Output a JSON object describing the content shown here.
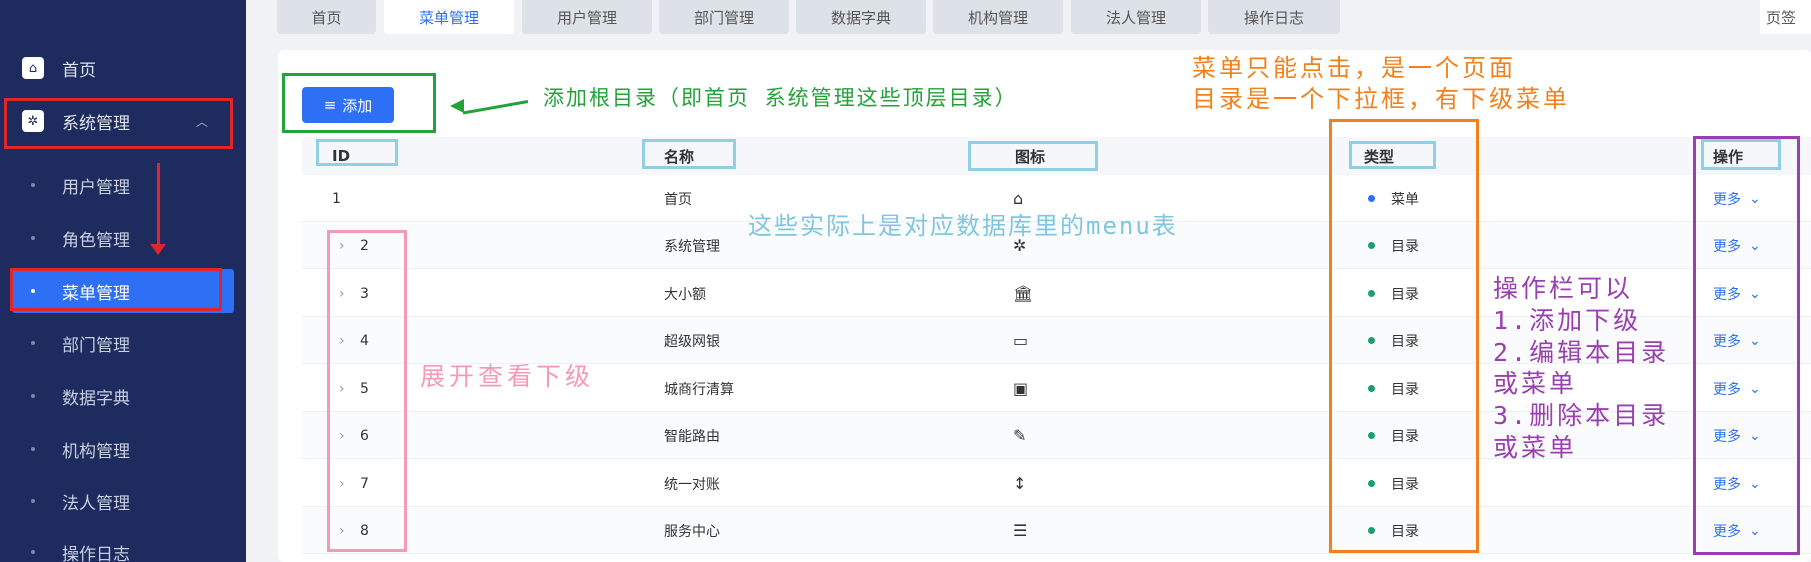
{
  "sidebar": {
    "home": {
      "label": "首页",
      "icon": "home-icon"
    },
    "system": {
      "label": "系统管理",
      "icon": "gear-icon",
      "caret": "chevron-up-icon"
    },
    "items": [
      {
        "label": "用户管理"
      },
      {
        "label": "角色管理"
      },
      {
        "label": "菜单管理"
      },
      {
        "label": "部门管理"
      },
      {
        "label": "数据字典"
      },
      {
        "label": "机构管理"
      },
      {
        "label": "法人管理"
      },
      {
        "label": "操作日志"
      }
    ],
    "active_index": 2
  },
  "tabs": [
    {
      "label": "首页"
    },
    {
      "label": "菜单管理"
    },
    {
      "label": "用户管理"
    },
    {
      "label": "部门管理"
    },
    {
      "label": "数据字典"
    },
    {
      "label": "机构管理"
    },
    {
      "label": "法人管理"
    },
    {
      "label": "操作日志"
    }
  ],
  "tabs_more": "页签",
  "toolbar": {
    "add_label": "添加",
    "add_icon": "list-icon"
  },
  "table": {
    "columns": [
      "ID",
      "名称",
      "图标",
      "类型",
      "操作"
    ],
    "rows": [
      {
        "id": "1",
        "name": "首页",
        "icon": "⌂",
        "icon_name": "home-icon",
        "type": "菜单",
        "action": "更多",
        "expandable": false
      },
      {
        "id": "2",
        "name": "系统管理",
        "icon": "✲",
        "icon_name": "gear-icon",
        "type": "目录",
        "action": "更多",
        "expandable": true
      },
      {
        "id": "3",
        "name": "大小额",
        "icon": "🏛",
        "icon_name": "bank-icon",
        "type": "目录",
        "action": "更多",
        "expandable": true
      },
      {
        "id": "4",
        "name": "超级网银",
        "icon": "▭",
        "icon_name": "credit-card-icon",
        "type": "目录",
        "action": "更多",
        "expandable": true
      },
      {
        "id": "5",
        "name": "城商行清算",
        "icon": "▣",
        "icon_name": "calculator-icon",
        "type": "目录",
        "action": "更多",
        "expandable": true
      },
      {
        "id": "6",
        "name": "智能路由",
        "icon": "✎",
        "icon_name": "plug-icon",
        "type": "目录",
        "action": "更多",
        "expandable": true
      },
      {
        "id": "7",
        "name": "统一对账",
        "icon": "↕",
        "icon_name": "sort-icon",
        "type": "目录",
        "action": "更多",
        "expandable": true
      },
      {
        "id": "8",
        "name": "服务中心",
        "icon": "☰",
        "icon_name": "sliders-icon",
        "type": "目录",
        "action": "更多",
        "expandable": true
      }
    ]
  },
  "annotations": {
    "add_note": "添加根目录（即首页 系统管理这些顶层目录）",
    "type_note_1": "菜单只能点击，是一个页面",
    "type_note_2": "目录是一个下拉框，有下级菜单",
    "db_note": "这些实际上是对应数据库里的menu表",
    "expand_note": "展开查看下级",
    "ops_note": [
      "操作栏可以",
      "1.添加下级",
      "2.编辑本目录",
      "或菜单",
      "3.删除本目录",
      "或菜单"
    ]
  },
  "colors": {
    "sidebar_bg": "#1d2b5e",
    "accent": "#2d6ff5",
    "menu_dot": "#2d6ff5",
    "dir_dot": "#1aa06d",
    "note_green": "#23a23a",
    "note_orange": "#f2811d",
    "note_blue": "#7fc6de",
    "note_pink": "#f59ab5",
    "note_purple": "#9a3fb0",
    "box_red": "#e0252b"
  }
}
